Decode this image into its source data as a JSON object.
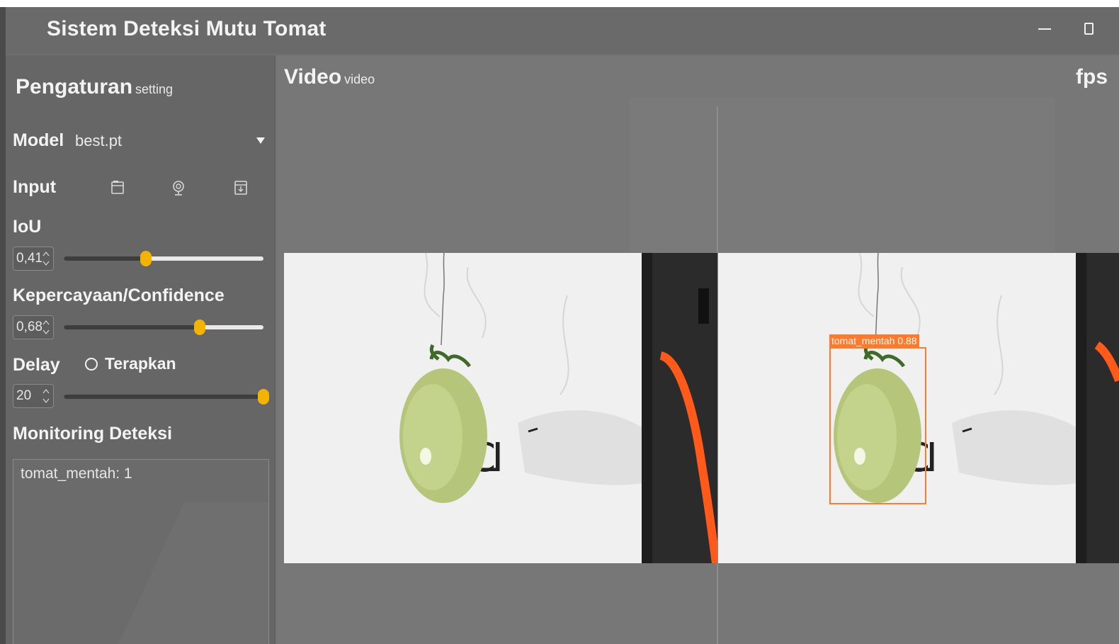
{
  "window": {
    "title": "Sistem Deteksi Mutu Tomat"
  },
  "sidebar": {
    "title": "Pengaturan",
    "title_sub": "setting",
    "model": {
      "label": "Model",
      "value": "best.pt"
    },
    "input": {
      "label": "Input",
      "icons": [
        "file-icon",
        "webcam-icon",
        "folder-icon"
      ]
    },
    "iou": {
      "label": "IoU",
      "value_text": "0,41",
      "value": 0.41
    },
    "confidence": {
      "label": "Kepercayaan/Confidence",
      "value_text": "0,68",
      "value": 0.68
    },
    "delay": {
      "label": "Delay",
      "value_text": "20",
      "value": 20,
      "slider_fraction": 1.0,
      "apply_label": "Terapkan"
    },
    "monitoring": {
      "label": "Monitoring Deteksi",
      "lines": [
        "tomat_mentah:  1"
      ]
    }
  },
  "main": {
    "title": "Video",
    "title_sub": "video",
    "fps_label": "fps"
  },
  "detection": {
    "label": "tomat_mentah  0.88"
  },
  "colors": {
    "accent": "#f3b400",
    "detection": "#ff7a2a",
    "panel": "#666666",
    "background": "#777777"
  }
}
